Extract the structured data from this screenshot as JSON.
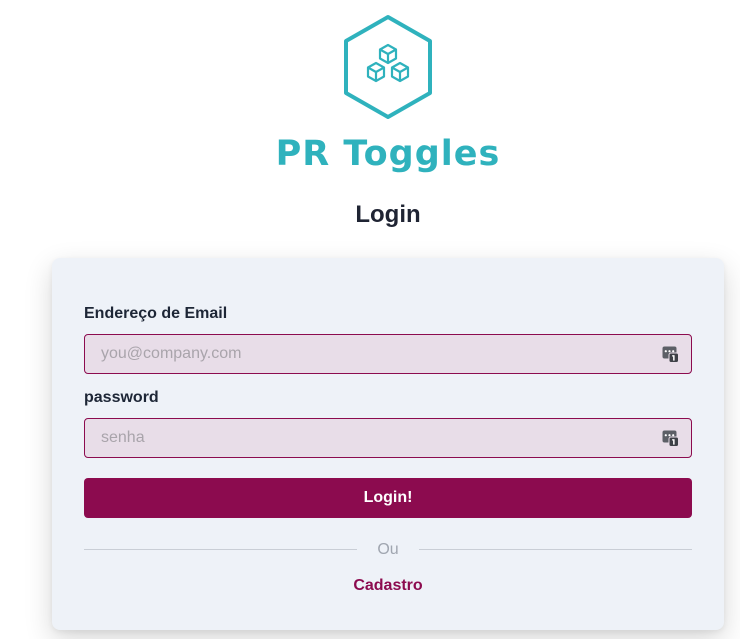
{
  "brand": {
    "name": "PR Toggles",
    "logo_icon": "hexagon-cubes-icon",
    "color": "#2fb2bd"
  },
  "page_title": "Login",
  "form": {
    "email_label": "Endereço de Email",
    "email_placeholder": "you@company.com",
    "email_value": "",
    "password_label": "password",
    "password_placeholder": "senha",
    "password_value": "",
    "field_icon": "password-manager-icon",
    "submit_label": "Login!",
    "divider_text": "Ou",
    "signup_label": "Cadastro"
  },
  "colors": {
    "accent": "#8c0b4f",
    "field_bg": "#e8dde8",
    "card_bg": "#eef2f8",
    "title": "#1f2433"
  }
}
